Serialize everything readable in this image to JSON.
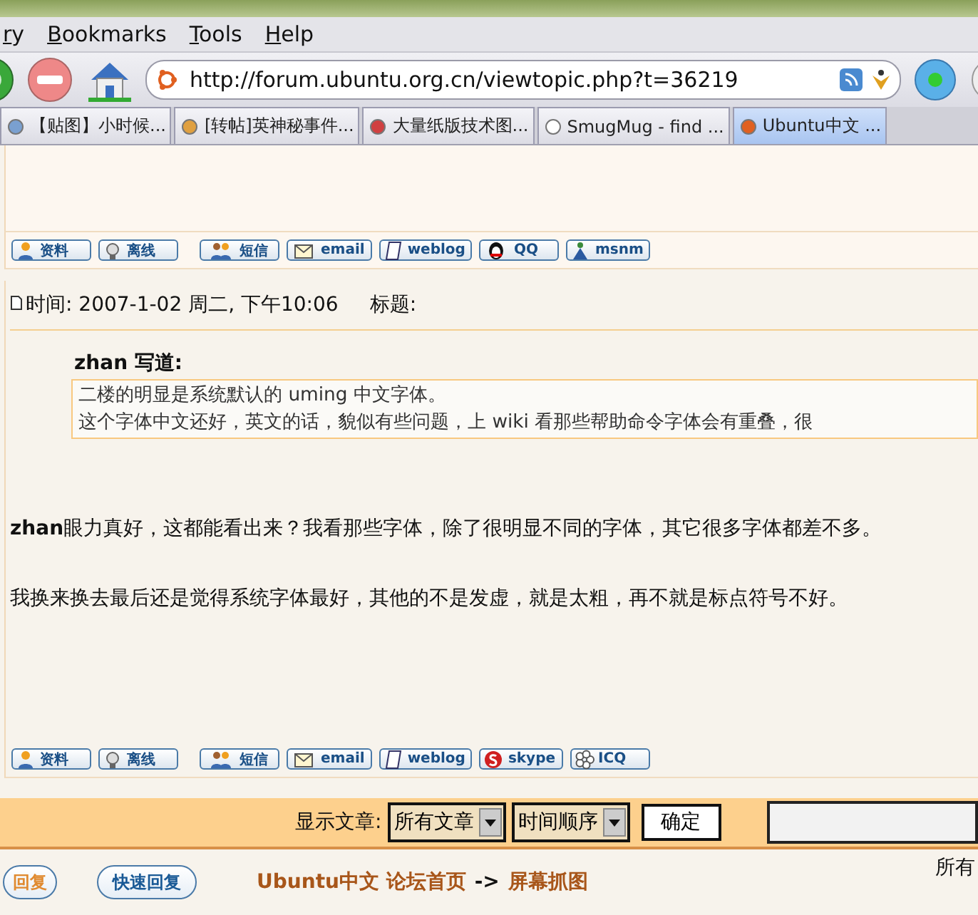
{
  "menu": [
    "ry",
    "Bookmarks",
    "Tools",
    "Help"
  ],
  "address": {
    "value": "http://forum.ubuntu.org.cn/viewtopic.php?t=36219"
  },
  "tabs": [
    {
      "label": "【贴图】小时候...",
      "selected": false
    },
    {
      "label": "[转帖]英神秘事件...",
      "selected": false
    },
    {
      "label": "大量纸版技术图...",
      "selected": false
    },
    {
      "label": "SmugMug - find ...",
      "selected": false
    },
    {
      "label": "Ubuntu中文 ...",
      "selected": true
    }
  ],
  "profile_buttons_1": [
    {
      "kind": "profile",
      "label": "资料"
    },
    {
      "kind": "offline",
      "label": "离线"
    },
    {
      "kind": "pm",
      "label": "短信"
    },
    {
      "kind": "email",
      "label": "email"
    },
    {
      "kind": "weblog",
      "label": "weblog"
    },
    {
      "kind": "qq",
      "label": "QQ"
    },
    {
      "kind": "msn",
      "label": "msnm"
    }
  ],
  "post": {
    "time": "时间: 2007-1-02 周二, 下午10:06",
    "subject": "标题:",
    "quote_author": "zhan 写道:",
    "quote_lines": [
      "二楼的明显是系统默认的 uming 中文字体。",
      "这个字体中文还好，英文的话，貌似有些问题，上 wiki 看那些帮助命令字体会有重叠，很"
    ],
    "paragraphs": [
      "**zhan**眼力真好，这都能看出来？我看那些字体，除了很明显不同的字体，其它很多字体都差不多。",
      "我换来换去最后还是觉得系统字体最好，其他的不是发虚，就是太粗，再不就是标点符号不好。"
    ]
  },
  "profile_buttons_2": [
    {
      "kind": "profile",
      "label": "资料"
    },
    {
      "kind": "offline",
      "label": "离线"
    },
    {
      "kind": "pm",
      "label": "短信"
    },
    {
      "kind": "email",
      "label": "email"
    },
    {
      "kind": "weblog",
      "label": "weblog"
    },
    {
      "kind": "skype",
      "label": "skype"
    },
    {
      "kind": "icq",
      "label": "ICQ"
    }
  ],
  "display_bar": {
    "label": "显示文章:",
    "select_1": "所有文章",
    "select_2": "时间顺序",
    "button": "确定"
  },
  "footer": {
    "reply_button": "回复",
    "quick_reply_button": "快速回复",
    "breadcrumb": [
      {
        "kind": "link",
        "text": "Ubuntu中文 论坛首页"
      },
      {
        "kind": "sep",
        "text": "->"
      },
      {
        "kind": "link",
        "text": "屏幕抓图"
      }
    ],
    "right_text": "所有"
  }
}
